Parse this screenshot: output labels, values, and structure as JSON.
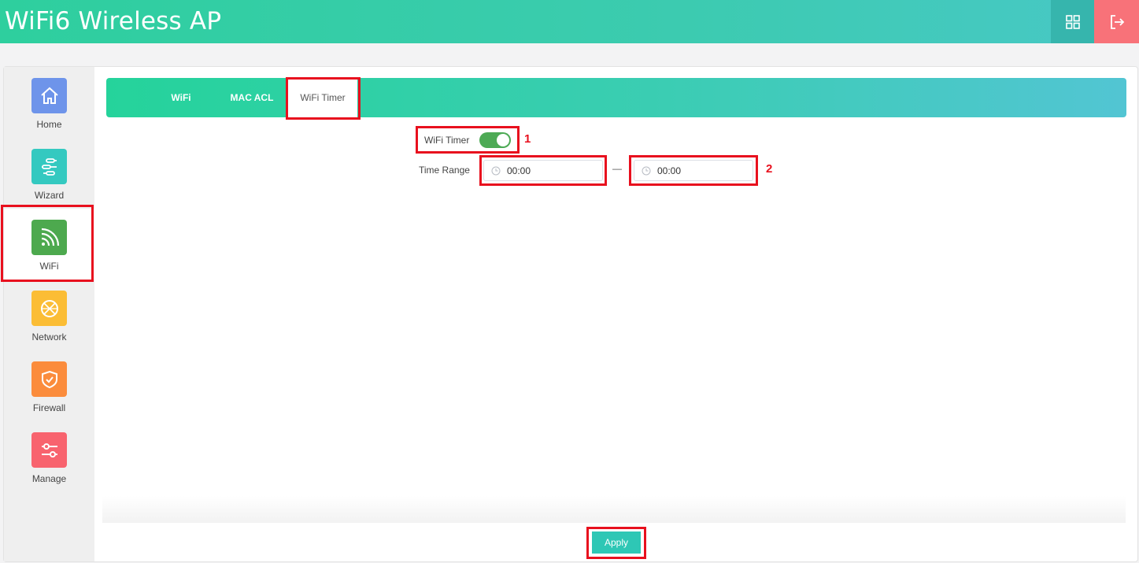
{
  "header": {
    "title": "WiFi6 Wireless AP",
    "grid_icon": "grid-icon",
    "logout_icon": "logout-icon",
    "colors": {
      "grid_bg": "#36b5ad",
      "logout_bg": "#f87279"
    }
  },
  "sidebar": {
    "items": [
      {
        "label": "Home",
        "icon": "home-icon",
        "color": "#6e94ea"
      },
      {
        "label": "Wizard",
        "icon": "wizard-icon",
        "color": "#34c9c0"
      },
      {
        "label": "WiFi",
        "icon": "wifi-icon",
        "color": "#4da94e",
        "active": true
      },
      {
        "label": "Network",
        "icon": "globe-icon",
        "color": "#fbbd35"
      },
      {
        "label": "Firewall",
        "icon": "shield-icon",
        "color": "#fb8c3c"
      },
      {
        "label": "Manage",
        "icon": "sliders-icon",
        "color": "#f8636e"
      }
    ]
  },
  "tabs": [
    {
      "label": "WiFi"
    },
    {
      "label": "MAC ACL"
    },
    {
      "label": "WiFi Timer",
      "active": true
    }
  ],
  "form": {
    "timer_label": "WiFi Timer",
    "timer_enabled": true,
    "time_range_label": "Time Range",
    "start_time": "00:00",
    "end_time": "00:00",
    "range_separator": "—"
  },
  "annotations": {
    "marker_1": "1",
    "marker_2": "2"
  },
  "footer": {
    "apply_label": "Apply"
  }
}
